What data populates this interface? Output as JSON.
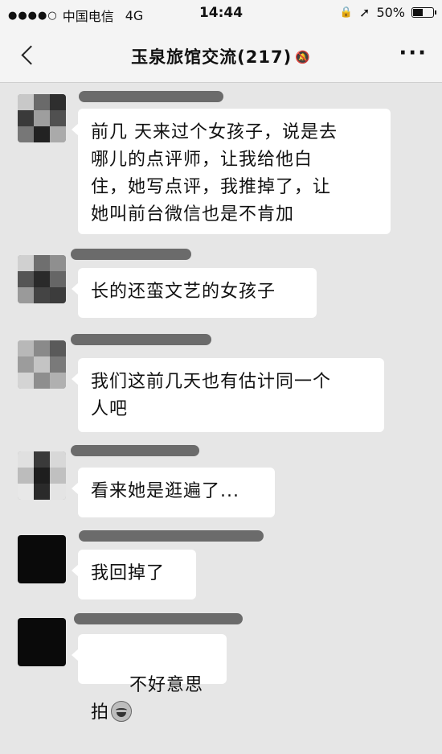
{
  "status_bar": {
    "signal": "●●●●○",
    "carrier": "中国电信",
    "network": "4G",
    "time": "14:44",
    "lock_icon": "🔒",
    "location_icon": "➚",
    "battery_percent": "50%",
    "battery_level": 0.5
  },
  "nav": {
    "back_icon": "chevron-left-icon",
    "title": "玉泉旅馆交流(217)",
    "mute_icon": "🔕",
    "more_label": "···"
  },
  "messages": [
    {
      "text": "前几 天来过个女孩子，说是去\n哪儿的点评师，让我给他白\n住，她写点评，我推掉了，让\n她叫前台微信也是不肯加"
    },
    {
      "text": "长的还蛮文艺的女孩子"
    },
    {
      "text": "我们这前几天也有估计同一个\n人吧"
    },
    {
      "text": "看来她是逛遍了..."
    },
    {
      "text": "我回掉了"
    },
    {
      "text": "不好意思拍",
      "emoji": "laughing-tears-icon"
    }
  ]
}
